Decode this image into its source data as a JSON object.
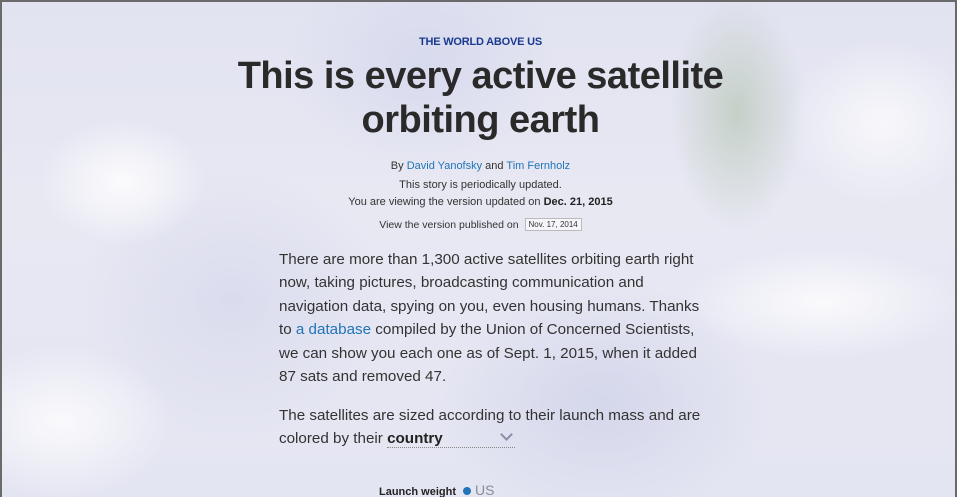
{
  "article": {
    "kicker": "THE WORLD ABOVE US",
    "title_line1": "This is every active satellite",
    "title_line2": "orbiting earth",
    "byline": {
      "by": "By ",
      "author1": "David Yanofsky",
      "and": " and ",
      "author2": "Tim Fernholz"
    },
    "update_note": "This story is periodically updated.",
    "viewing_prefix": "You are viewing the version updated on ",
    "viewing_date": "Dec. 21, 2015",
    "published_prefix": "View the version published on",
    "published_date": "Nov. 17, 2014",
    "para1_before_link": "There are more than 1,300 active satellites orbiting earth right now, taking pictures, broadcasting communication and navigation data, spying on you, even housing humans. Thanks to ",
    "para1_link": "a database",
    "para1_after_link": " compiled by the Union of Concerned Scientists, we can show you each one as of Sept. 1, 2015, when it added 87 sats and removed 47.",
    "para2_text": "The satellites are sized according to their launch mass and are colored by their ",
    "color_by_select": "country"
  },
  "legend": {
    "launch_weight_label": "Launch weight",
    "first_country": "US",
    "first_country_color": "#2274b8"
  }
}
